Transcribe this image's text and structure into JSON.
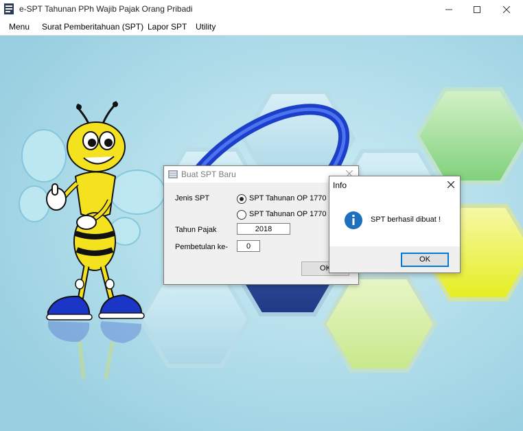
{
  "window": {
    "title": "e-SPT Tahunan PPh Wajib Pajak Orang Pribadi",
    "icon": "app-icon",
    "controls": [
      "minimize-icon",
      "maximize-icon",
      "close-icon"
    ]
  },
  "menu": {
    "items": [
      {
        "label": "Menu"
      },
      {
        "label": "Surat Pemberitahuan (SPT)"
      },
      {
        "label": "Lapor SPT"
      },
      {
        "label": "Utility"
      }
    ]
  },
  "dialog_buat_spt": {
    "title": "Buat SPT Baru",
    "jenis_spt_label": "Jenis SPT",
    "option_1770": "SPT Tahunan OP 1770",
    "option_1770s": "SPT Tahunan OP 1770 S",
    "selected_option": "SPT Tahunan OP 1770",
    "tahun_pajak_label": "Tahun Pajak",
    "tahun_pajak_value": "2018",
    "pembetulan_label": "Pembetulan ke-",
    "pembetulan_value": "0",
    "ok_label": "OK"
  },
  "dialog_info": {
    "title": "Info",
    "message": "SPT berhasil dibuat !",
    "icon": "info-icon",
    "ok_label": "OK"
  },
  "colors": {
    "desktop_bg": "#a8d8e6",
    "dialog_bg": "#f0f0f0",
    "info_icon": "#1f6fbf",
    "focus_border": "#0078d7"
  }
}
